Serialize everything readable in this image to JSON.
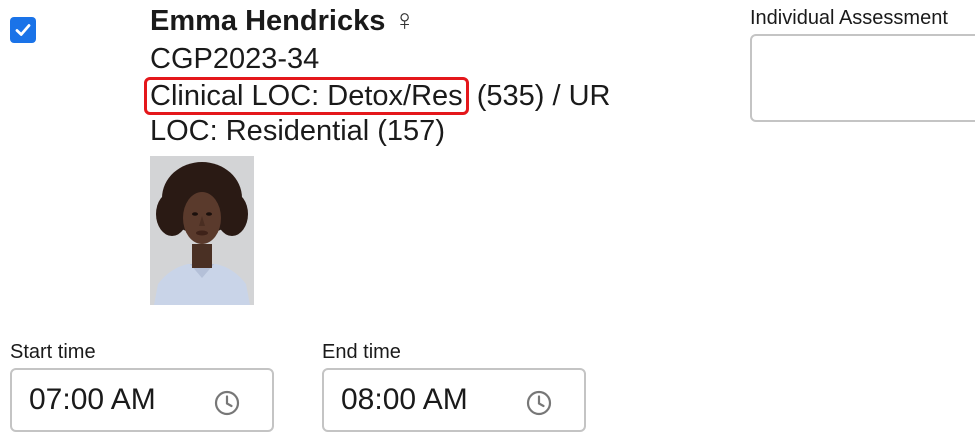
{
  "client": {
    "name": "Emma Hendricks",
    "gender_symbol": "♀",
    "id": "CGP2023-34",
    "clinical_loc_label": "Clinical LOC: Detox/Res",
    "clinical_loc_suffix": " (535) / UR",
    "loc": "LOC: Residential (157)",
    "selected": true
  },
  "assessment": {
    "label": "Individual Assessment",
    "value": ""
  },
  "times": {
    "start_label": "Start time",
    "start_value": "07:00 AM",
    "end_label": "End time",
    "end_value": "08:00 AM"
  },
  "colors": {
    "checkbox": "#1a73e8",
    "highlight": "#e4171b"
  },
  "icons": {
    "checkbox": "checkmark-icon",
    "gender": "female-icon",
    "clock": "clock-icon"
  }
}
